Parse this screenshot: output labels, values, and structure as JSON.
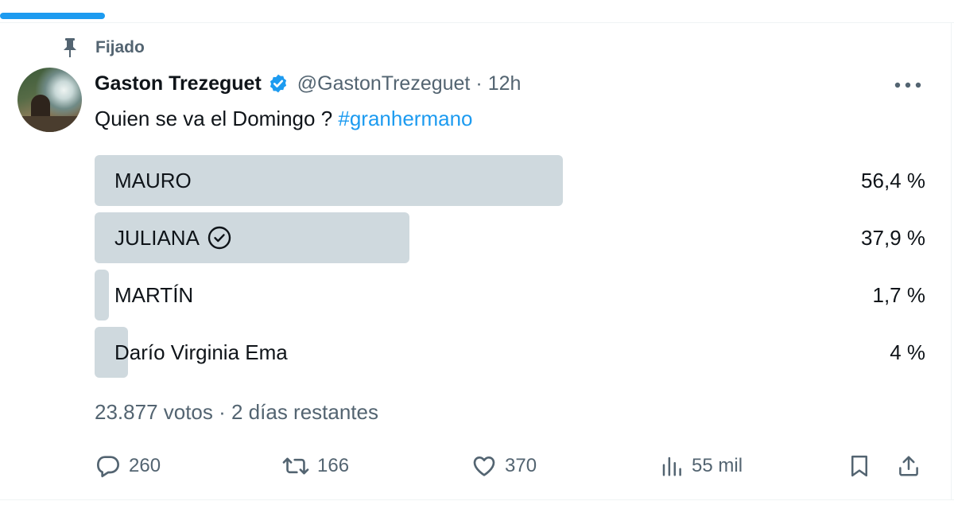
{
  "pinned": {
    "label": "Fijado"
  },
  "author": {
    "name": "Gaston Trezeguet",
    "handle": "@GastonTrezeguet",
    "separator": "·",
    "time": "12h"
  },
  "tweet": {
    "text": "Quien se va el Domingo ? ",
    "hashtag": "#granhermano"
  },
  "poll": {
    "options": [
      {
        "label": "MAURO",
        "percent_text": "56,4 %",
        "percent": 56.4
      },
      {
        "label": "JULIANA",
        "percent_text": "37,9 %",
        "percent": 37.9,
        "selected": true
      },
      {
        "label": "MARTÍN",
        "percent_text": "1,7 %",
        "percent": 1.7
      },
      {
        "label": "Darío Virginia Ema",
        "percent_text": "4 %",
        "percent": 4
      }
    ],
    "meta": "23.877 votos · 2 días restantes"
  },
  "actions": {
    "replies": "260",
    "reposts": "166",
    "likes": "370",
    "views": "55 mil"
  },
  "colors": {
    "accent": "#1d9bf0",
    "bar": "#cfd9de",
    "secondary_text": "#536471"
  }
}
